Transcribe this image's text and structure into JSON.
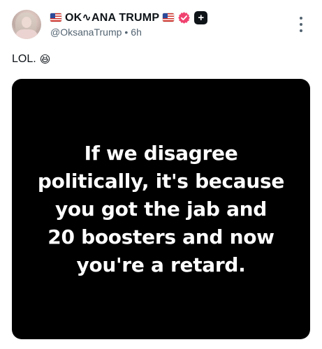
{
  "post": {
    "author": {
      "display_name": "OK∿ANA TRUMP",
      "handle": "@OksanaTrump",
      "separator": "•",
      "time": "6h",
      "flag_icon": "us-flag-icon",
      "verified_icon": "verified-badge-icon",
      "plus_icon": "plus-badge-icon",
      "plus_symbol": "+"
    },
    "text": "LOL.",
    "text_emoji": "😆",
    "media": {
      "lines": [
        "If we disagree",
        "politically, it's because",
        "you got the jab and",
        "20 boosters and now",
        "you're a retard."
      ]
    },
    "more_icon": "more-vertical-icon"
  },
  "colors": {
    "verified_badge": "#f0426f",
    "secondary_text": "#536471",
    "media_background": "#000000"
  }
}
